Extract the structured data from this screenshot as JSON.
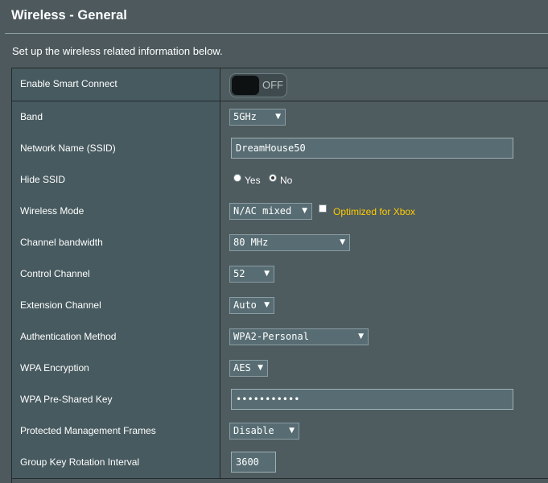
{
  "page": {
    "title": "Wireless - General",
    "description": "Set up the wireless related information below."
  },
  "rows": {
    "smart_connect": {
      "label": "Enable Smart Connect",
      "toggle_text": "OFF",
      "enabled": false
    },
    "band": {
      "label": "Band",
      "value": "5GHz"
    },
    "ssid": {
      "label": "Network Name (SSID)",
      "value": "DreamHouse50"
    },
    "hide_ssid": {
      "label": "Hide SSID",
      "option_yes": "Yes",
      "option_no": "No",
      "selected": "No"
    },
    "wireless_mode": {
      "label": "Wireless Mode",
      "value": "N/AC mixed",
      "xbox_label": "Optimized for Xbox",
      "xbox_checked": false
    },
    "channel_bandwidth": {
      "label": "Channel bandwidth",
      "value": "80 MHz"
    },
    "control_channel": {
      "label": "Control Channel",
      "value": "52"
    },
    "extension_channel": {
      "label": "Extension Channel",
      "value": "Auto"
    },
    "auth_method": {
      "label": "Authentication Method",
      "value": "WPA2-Personal"
    },
    "wpa_encryption": {
      "label": "WPA Encryption",
      "value": "AES"
    },
    "wpa_key": {
      "label": "WPA Pre-Shared Key",
      "value": "•••••••••••"
    },
    "pmf": {
      "label": "Protected Management Frames",
      "value": "Disable"
    },
    "group_key": {
      "label": "Group Key Rotation Interval",
      "value": "3600"
    }
  },
  "icons": {
    "dropdown_arrow": "▼"
  },
  "colors": {
    "background": "#4d595d",
    "label_cell": "#475a5f",
    "accent_xbox": "#ffcc00"
  }
}
